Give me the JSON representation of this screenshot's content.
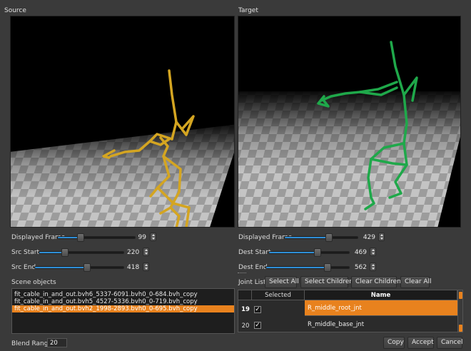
{
  "source": {
    "title": "Source",
    "displayed_frame": {
      "label": "Displayed Frame",
      "value": "99",
      "fraction": 0.29
    },
    "src_start": {
      "label": "Src Start",
      "value": "220",
      "fraction": 0.3
    },
    "src_end": {
      "label": "Src End",
      "value": "418",
      "fraction": 0.58
    }
  },
  "target": {
    "title": "Target",
    "displayed_frame": {
      "label": "Displayed Frame",
      "value": "429",
      "fraction": 0.6
    },
    "dest_start": {
      "label": "Dest Start",
      "value": "469",
      "fraction": 0.6
    },
    "dest_end": {
      "label": "Dest End",
      "value": "562",
      "fraction": 0.73
    }
  },
  "scene_objects": {
    "label": "Scene objects",
    "items": [
      "fit_cable_in_and_out.bvh6_5337-6091.bvh0_0-684.bvh_copy",
      "fit_cable_in_and_out.bvh5_4527-5336.bvh0_0-719.bvh_copy",
      "fit_cable_in_and_out.bvh2_1998-2893.bvh0_0-695.bvh_copy"
    ],
    "selected_index": 2
  },
  "joint_list": {
    "label": "Joint List",
    "buttons": {
      "select_all": "Select All",
      "select_children": "Select Children",
      "clear_children": "Clear Children",
      "clear_all": "Clear All"
    },
    "columns": {
      "selected": "Selected",
      "name": "Name"
    },
    "rows": [
      {
        "num": "19",
        "checked": "✓",
        "name": "R_middle_root_jnt",
        "highlighted": true
      },
      {
        "num": "20",
        "checked": "✓",
        "name": "R_middle_base_jnt",
        "highlighted": false
      }
    ]
  },
  "blend_range": {
    "label": "Blend Range",
    "value": "20"
  },
  "footer_buttons": {
    "copy": "Copy",
    "accept": "Accept",
    "cancel": "Cancel"
  },
  "colors": {
    "accent": "#e8821e",
    "slider": "#2f8fd8",
    "source_skeleton": "#d4a521",
    "target_skeleton": "#1fa84a"
  }
}
